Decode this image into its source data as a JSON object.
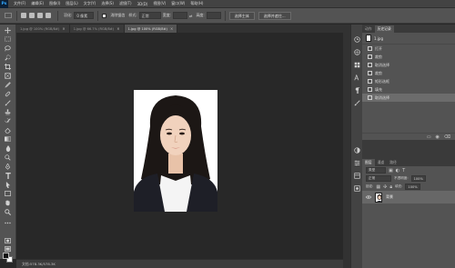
{
  "menubar": {
    "logo": "Ps",
    "items": [
      "文件(F)",
      "编辑(E)",
      "图像(I)",
      "图层(L)",
      "文字(Y)",
      "选择(S)",
      "滤镜(T)",
      "3D(D)",
      "视图(V)",
      "窗口(W)",
      "帮助(H)"
    ]
  },
  "options": {
    "feather_label": "羽化:",
    "feather_value": "0 像素",
    "antialias_label": "消除锯齿",
    "style_label": "样式:",
    "style_value": "正常",
    "width_label": "宽度:",
    "height_label": "高度:",
    "select_subject": "选择主体",
    "select_mask": "选择并遮住..."
  },
  "tabs": [
    {
      "label": "1.jpg @ 100% (RGB/8#)",
      "active": false
    },
    {
      "label": "1.jpg @ 66.7% (RGB/8#)",
      "active": false
    },
    {
      "label": "1.jpg @ 100% (RGB/8#)",
      "active": true
    }
  ],
  "status": {
    "text": "文档:578.3K/578.3K"
  },
  "history_panel": {
    "tabs": [
      "历史记录",
      "动作"
    ],
    "snapshot": "1.jpg",
    "rows": [
      {
        "label": "打开",
        "selected": false
      },
      {
        "label": "裁剪",
        "selected": false
      },
      {
        "label": "取消选择",
        "selected": false
      },
      {
        "label": "裁剪",
        "selected": false
      },
      {
        "label": "矩形选框",
        "selected": false
      },
      {
        "label": "填充",
        "selected": false
      },
      {
        "label": "取消选择",
        "selected": true
      }
    ]
  },
  "layers_panel": {
    "tabs": [
      "图层",
      "通道",
      "路径"
    ],
    "kind_label": "类型",
    "blend_mode": "正常",
    "opacity_label": "不透明度:",
    "opacity_value": "100%",
    "lock_label": "锁定:",
    "fill_label": "填充:",
    "fill_value": "100%",
    "layers": [
      {
        "name": "背景",
        "visible": true
      }
    ]
  },
  "colors": {
    "foreground": "#111111",
    "background": "#ffffff",
    "accent": "#31a8ff"
  }
}
